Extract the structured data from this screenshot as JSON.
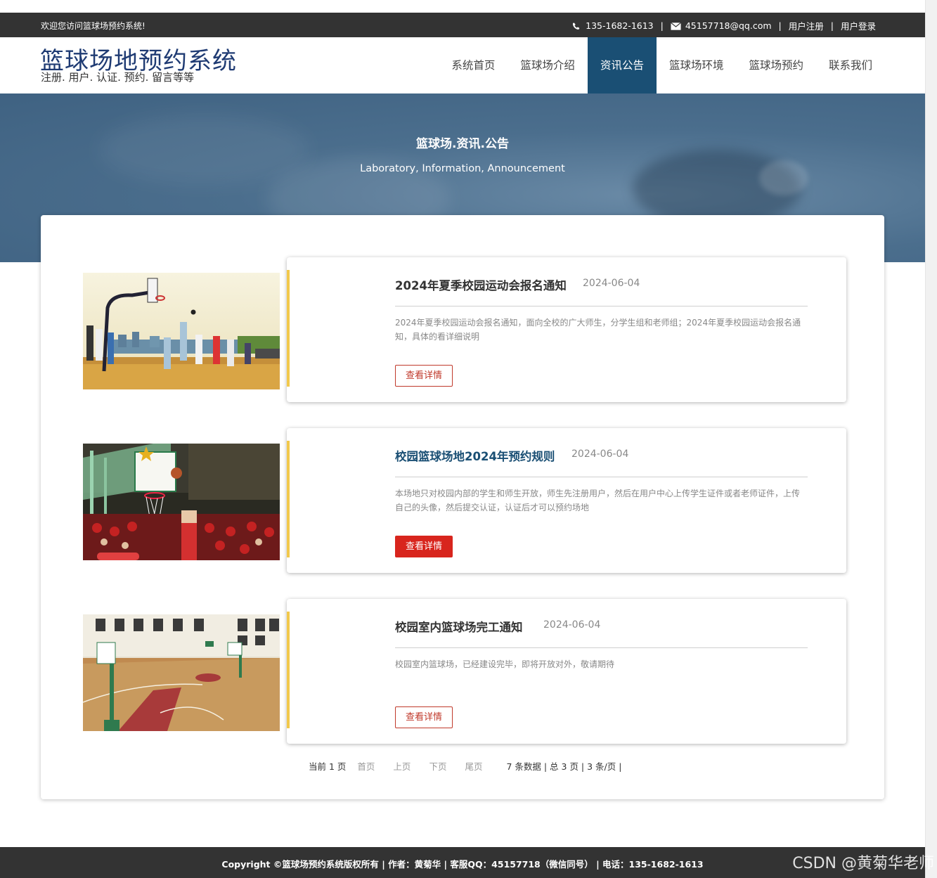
{
  "topbar": {
    "welcome": "欢迎您访问篮球场预约系统!",
    "phone": "135-1682-1613",
    "email": "45157718@qq.com",
    "separator": "|",
    "register": "用户注册",
    "login": "用户登录"
  },
  "header": {
    "title": "篮球场地预约系统",
    "subtitle": "注册. 用户. 认证. 预约. 留言等等"
  },
  "nav": {
    "items": [
      {
        "label": "系统首页"
      },
      {
        "label": "篮球场介绍"
      },
      {
        "label": "资讯公告"
      },
      {
        "label": "篮球场环境"
      },
      {
        "label": "篮球场预约"
      },
      {
        "label": "联系我们"
      }
    ],
    "active_index": 2
  },
  "banner": {
    "title": "篮球场.资讯.公告",
    "subtitle": "Laboratory, Information, Announcement"
  },
  "news": [
    {
      "title": "2024年夏季校园运动会报名通知",
      "date": "2024-06-04",
      "desc": "2024年夏季校园运动会报名通知，面向全校的广大师生，分学生组和老师组；2024年夏季校园运动会报名通知，具体的看详细说明",
      "button": "查看详情"
    },
    {
      "title": "校园篮球场地2024年预约规则",
      "date": "2024-06-04",
      "desc": "本场地只对校园内部的学生和师生开放，师生先注册用户，然后在用户中心上传学生证件或者老师证件，上传自己的头像，然后提交认证，认证后才可以预约场地",
      "button": "查看详情"
    },
    {
      "title": "校园室内篮球场完工通知",
      "date": "2024-06-04",
      "desc": "校园室内篮球场，已经建设完毕，即将开放对外，敬请期待",
      "button": "查看详情"
    }
  ],
  "pager": {
    "current": "当前 1 页",
    "first": "首页",
    "prev": "上页",
    "next": "下页",
    "last": "尾页",
    "stats": "7 条数据 | 总 3 页 | 3 条/页 |"
  },
  "footer": {
    "copyright": "Copyright ©篮球场预约系统版权所有 | 作者：黄菊华 | 客服QQ：45157718（微信同号） | 电话：135-1682-1613"
  },
  "watermark": "CSDN @黄菊华老师",
  "colors": {
    "dark_bar": "#333333",
    "brand_blue": "#1a4f74",
    "accent_red": "#d8251d",
    "accent_yellow": "#f2c94c"
  }
}
